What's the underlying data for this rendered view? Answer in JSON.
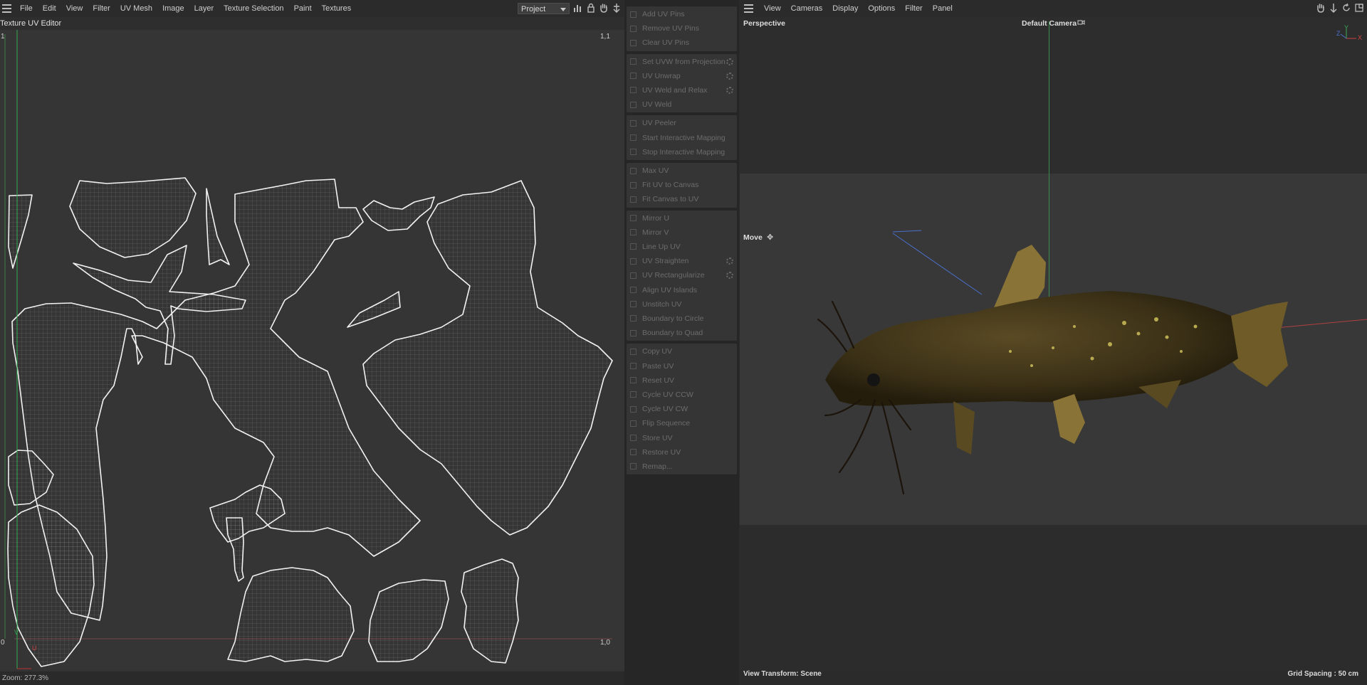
{
  "uv_editor": {
    "menu": [
      "File",
      "Edit",
      "View",
      "Filter",
      "UV Mesh",
      "Image",
      "Layer",
      "Texture Selection",
      "Paint",
      "Textures"
    ],
    "project_select": "Project",
    "title": "Texture UV Editor",
    "corner_top_left": "1",
    "corner_top_right": "1,1",
    "corner_bottom_left": "0",
    "corner_bottom_right": "1,0",
    "axis_v": "V",
    "axis_u": "U",
    "zoom": "Zoom: 277.3%"
  },
  "commands": {
    "groups": [
      {
        "items": [
          {
            "label": "Add UV Pins",
            "icon": "pin-icon"
          },
          {
            "label": "Remove UV Pins",
            "icon": "pin-remove-icon"
          },
          {
            "label": "Clear UV Pins",
            "icon": "x-icon"
          }
        ]
      },
      {
        "items": [
          {
            "label": "Set UVW from Projection",
            "icon": "projection-icon",
            "gear": true
          },
          {
            "label": "UV Unwrap",
            "icon": "unwrap-icon",
            "gear": true
          },
          {
            "label": "UV Weld and Relax",
            "icon": "weld-relax-icon",
            "gear": true
          },
          {
            "label": "UV Weld",
            "icon": "weld-icon"
          }
        ]
      },
      {
        "items": [
          {
            "label": "UV Peeler",
            "icon": "peeler-icon"
          },
          {
            "label": "Start Interactive Mapping",
            "icon": "play-icon"
          },
          {
            "label": "Stop Interactive Mapping",
            "icon": "stop-icon"
          }
        ]
      },
      {
        "items": [
          {
            "label": "Max UV",
            "icon": "max-uv-icon"
          },
          {
            "label": "Fit UV to Canvas",
            "icon": "fit-canvas-icon"
          },
          {
            "label": "Fit Canvas to UV",
            "icon": "fit-uv-icon"
          }
        ]
      },
      {
        "items": [
          {
            "label": "Mirror U",
            "icon": "mirror-u-icon"
          },
          {
            "label": "Mirror V",
            "icon": "mirror-v-icon"
          },
          {
            "label": "Line Up UV",
            "icon": "line-up-icon"
          },
          {
            "label": "UV Straighten",
            "icon": "straighten-icon",
            "gear": true
          },
          {
            "label": "UV Rectangularize",
            "icon": "rectangularize-icon",
            "gear": true
          },
          {
            "label": "Align UV Islands",
            "icon": "align-icon"
          },
          {
            "label": "Unstitch UV",
            "icon": "unstitch-icon"
          },
          {
            "label": "Boundary to Circle",
            "icon": "circle-icon"
          },
          {
            "label": "Boundary to Quad",
            "icon": "quad-icon"
          }
        ]
      },
      {
        "items": [
          {
            "label": "Copy UV",
            "icon": "copy-icon"
          },
          {
            "label": "Paste UV",
            "icon": "paste-icon"
          },
          {
            "label": "Reset UV",
            "icon": "reset-icon"
          },
          {
            "label": "Cycle UV CCW",
            "icon": "cycle-ccw-icon"
          },
          {
            "label": "Cycle UV CW",
            "icon": "cycle-cw-icon"
          },
          {
            "label": "Flip Sequence",
            "icon": "flip-icon"
          },
          {
            "label": "Store UV",
            "icon": "store-icon"
          },
          {
            "label": "Restore UV",
            "icon": "restore-icon"
          },
          {
            "label": "Remap...",
            "icon": "remap-icon"
          }
        ]
      }
    ]
  },
  "viewport": {
    "menu": [
      "View",
      "Cameras",
      "Display",
      "Options",
      "Filter",
      "Panel"
    ],
    "perspective": "Perspective",
    "camera": "Default Camera",
    "move": "Move",
    "view_transform": "View Transform: Scene",
    "grid_spacing": "Grid Spacing : 50 cm",
    "axis_x": "X",
    "axis_y": "Y",
    "axis_z": "Z"
  }
}
